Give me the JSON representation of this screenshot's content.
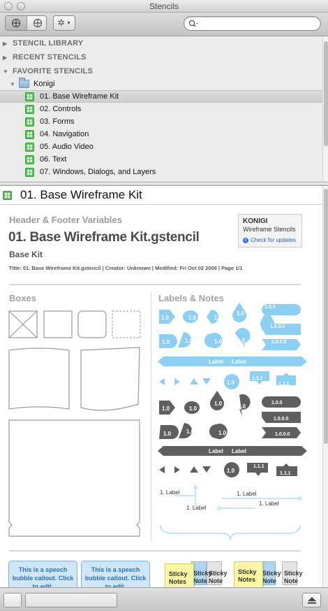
{
  "window": {
    "title": "Stencils"
  },
  "toolbar": {
    "search_placeholder": ""
  },
  "tree": {
    "sections": [
      "STENCIL LIBRARY",
      "RECENT STENCILS",
      "FAVORITE STENCILS"
    ],
    "folder": "Konigi",
    "items": [
      {
        "label": "01. Base Wireframe Kit",
        "selected": true
      },
      {
        "label": "02. Controls"
      },
      {
        "label": "03. Forms"
      },
      {
        "label": "04. Navigation"
      },
      {
        "label": "05. Audio Video"
      },
      {
        "label": "06. Text"
      },
      {
        "label": "07. Windows, Dialogs, and Layers"
      }
    ]
  },
  "preview": {
    "title": "01. Base Wireframe Kit",
    "header_footer": "Header & Footer Variables",
    "filename": "01. Base Wireframe Kit.gstencil",
    "subtitle": "Base Kit",
    "meta": "Title: 01. Base Wireframe Kit.gstencil  |  Creator: Unknown  |  Modified: Fri Oct 02 2009  |  Page 1/1",
    "badge": {
      "brand": "KONIGI",
      "line": "Wireframe Stencils",
      "link": "Check for updates"
    },
    "boxes_title": "Boxes",
    "labels_title": "Labels & Notes",
    "pin_label": "1.0",
    "pill_labels": [
      "1.0.0",
      "1.0.0.0",
      "1.0.0.0"
    ],
    "bar_labels": [
      "Label",
      "Label"
    ],
    "small_bubble": "1.0",
    "bubble_111": "1.1.1",
    "dark_pill_labels": [
      "1.0.0",
      "1.0.0.0",
      "1.0.0.0"
    ],
    "dark_bar_labels": [
      "Label",
      "Label"
    ],
    "note_labels": [
      "1. Label",
      "1. Label",
      "1. Label",
      "1. Label"
    ],
    "speech_bubble": "This is a speech bubble callout. Click to edit.",
    "sticky_label": "Sticky Notes",
    "sticky_short": "Sticky Note"
  },
  "colors": {
    "accent_blue": "#8ccff2",
    "dark_grey": "#616161",
    "selection": "#d4d4d4"
  }
}
